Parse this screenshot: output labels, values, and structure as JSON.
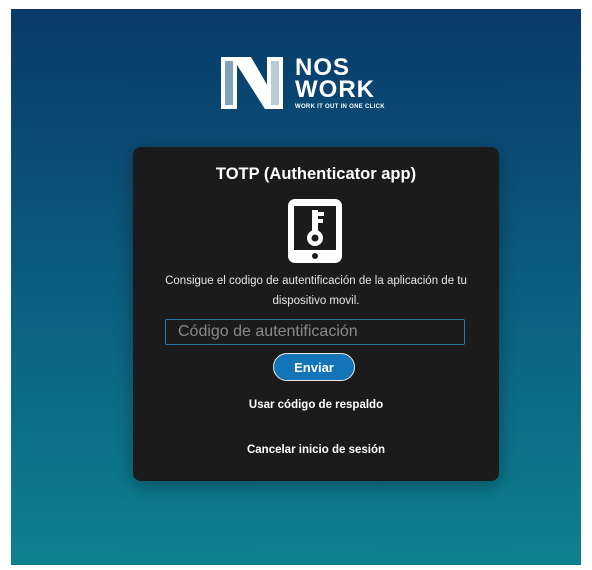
{
  "brand": {
    "line1": "NOS",
    "line2": "WORK",
    "tagline": "WORK IT OUT IN ONE CLICK",
    "logo_icon": "nos-work-n-logo"
  },
  "card": {
    "title": "TOTP (Authenticator app)",
    "icon": "phone-key-icon",
    "description": "Consigue el codigo de autentificación de la aplicación de tu dispositivo movil.",
    "code_input": {
      "placeholder": "Código de autentificación",
      "value": ""
    },
    "submit_label": "Enviar",
    "backup_link": "Usar código de respaldo",
    "cancel_link": "Cancelar inicio de sesión"
  },
  "colors": {
    "background_top": "#0a3a6a",
    "background_bottom": "#0d8190",
    "card_bg": "#1b1b1b",
    "button_blue": "#1474b8",
    "input_border": "#2a78a8"
  }
}
